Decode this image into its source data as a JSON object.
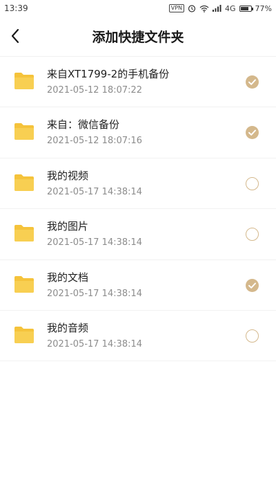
{
  "status_bar": {
    "time": "13:39",
    "vpn": "VPN",
    "network": "4G",
    "battery": "77%",
    "battery_level": 0.77
  },
  "header": {
    "title": "添加快捷文件夹"
  },
  "colors": {
    "accent": "#d4b88c",
    "folder": "#f5c33b"
  },
  "folders": [
    {
      "name": "来自XT1799-2的手机备份",
      "date": "2021-05-12 18:07:22",
      "selected": true
    },
    {
      "name": "来自：微信备份",
      "date": "2021-05-12 18:07:16",
      "selected": true
    },
    {
      "name": "我的视频",
      "date": "2021-05-17 14:38:14",
      "selected": false
    },
    {
      "name": "我的图片",
      "date": "2021-05-17 14:38:14",
      "selected": false
    },
    {
      "name": "我的文档",
      "date": "2021-05-17 14:38:14",
      "selected": true
    },
    {
      "name": "我的音频",
      "date": "2021-05-17 14:38:14",
      "selected": false
    }
  ]
}
